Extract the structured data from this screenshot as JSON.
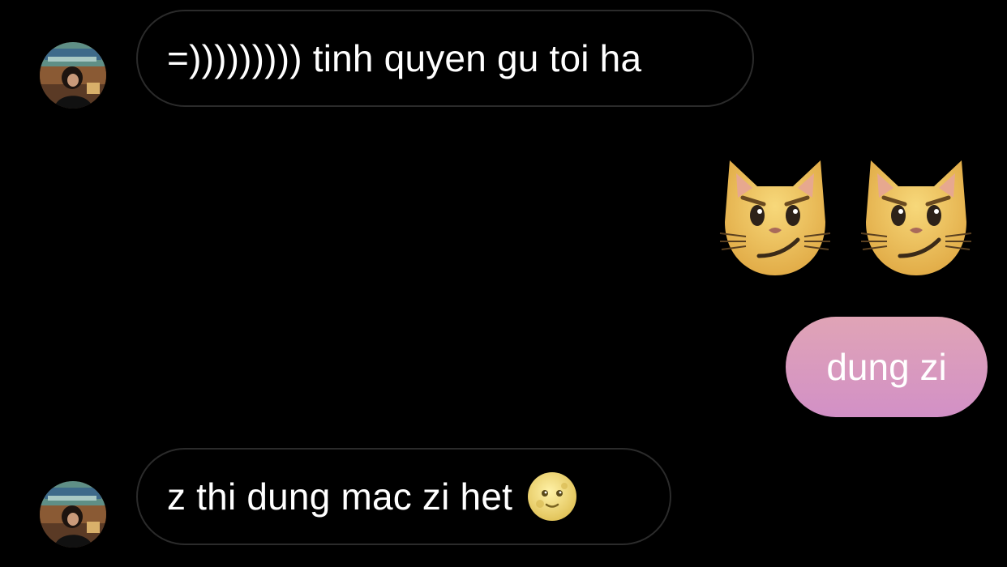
{
  "conversation": {
    "messages": [
      {
        "sender": "them",
        "text": "=))))))))) tinh quyen gu toi ha",
        "emoji": null
      },
      {
        "sender": "me",
        "text": "",
        "emoji": [
          "smirking-cat-face",
          "smirking-cat-face"
        ]
      },
      {
        "sender": "me",
        "text": "dung zi",
        "emoji": null
      },
      {
        "sender": "them",
        "text": "z thi dung mac zi het",
        "emoji": "full-moon-face"
      }
    ]
  },
  "colors": {
    "background": "#000000",
    "incoming_border": "#2b2b2b",
    "outgoing_gradient_top": "#e0a4b6",
    "outgoing_gradient_bottom": "#d290c6",
    "text": "#ffffff"
  },
  "icons": {
    "avatar": "contact-avatar-photo",
    "cat": "smirking-cat-face",
    "moon": "full-moon-face"
  }
}
